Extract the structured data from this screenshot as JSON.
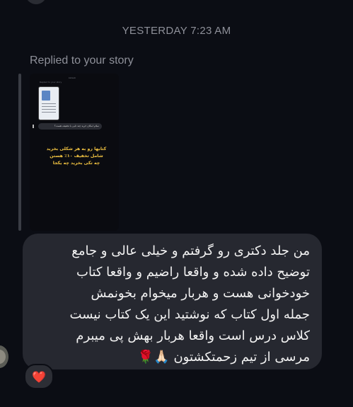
{
  "timestamp": "YESTERDAY 7:23 AM",
  "reply_header": "Replied to your story",
  "story": {
    "inner_header": "ketaab",
    "reply_caption": "Replied to your story",
    "mini_bubble_text": "سلام امکان خرید چند تایی با تخفیف هست؟",
    "overlay_lines": [
      "کتابها رو به هر شکلی بخرید",
      "شامل تخفیف ۱۰٪ هستن",
      "چه تکی بخرید چه یکجا"
    ]
  },
  "message": {
    "text": "من جلد دکتری رو گرفتم و خیلی عالی و جامع\nتوضیح داده شده و واقعا راضیم و واقعا کتاب\nخودخوانی هست و هربار میخوام بخونمش\nجمله اول کتاب که نوشتید این یک کتاب نیست\nکلاس درس است واقعا هربار بهش پی میبرم\nمرسی از تیم زحمتکشتون 🙏🏻🌹"
  },
  "reaction": {
    "emoji": "❤️",
    "icon": "heart-icon",
    "color": "#ff3b55"
  },
  "colors": {
    "background": "#0b0d14",
    "bubble": "#262830",
    "muted_text": "#8e9099",
    "story_overlay": "#f4c542"
  }
}
